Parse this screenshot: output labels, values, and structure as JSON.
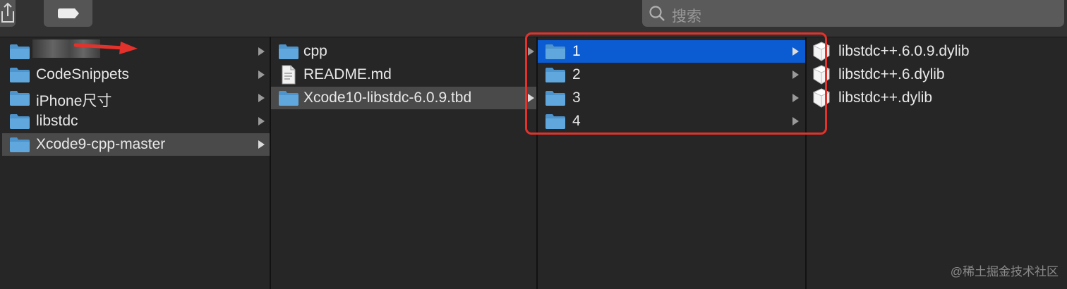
{
  "search": {
    "placeholder": "搜索"
  },
  "columns": [
    {
      "items": [
        {
          "label": "",
          "type": "folder",
          "arrow": true,
          "state": ""
        },
        {
          "label": "CodeSnippets",
          "type": "folder",
          "arrow": true,
          "state": ""
        },
        {
          "label": "iPhone尺寸",
          "type": "folder",
          "arrow": true,
          "state": ""
        },
        {
          "label": "libstdc",
          "type": "folder",
          "arrow": true,
          "state": ""
        },
        {
          "label": "Xcode9-cpp-master",
          "type": "folder",
          "arrow": true,
          "state": "selected-inactive"
        }
      ]
    },
    {
      "items": [
        {
          "label": "cpp",
          "type": "folder",
          "arrow": true,
          "state": ""
        },
        {
          "label": "README.md",
          "type": "document",
          "arrow": false,
          "state": ""
        },
        {
          "label": "Xcode10-libstdc-6.0.9.tbd",
          "type": "folder",
          "arrow": true,
          "state": "selected-inactive"
        }
      ]
    },
    {
      "items": [
        {
          "label": "1",
          "type": "folder",
          "arrow": true,
          "state": "selected-active"
        },
        {
          "label": "2",
          "type": "folder",
          "arrow": true,
          "state": ""
        },
        {
          "label": "3",
          "type": "folder",
          "arrow": true,
          "state": ""
        },
        {
          "label": "4",
          "type": "folder",
          "arrow": true,
          "state": ""
        }
      ]
    },
    {
      "items": [
        {
          "label": "libstdc++.6.0.9.dylib",
          "type": "dylib",
          "arrow": false,
          "state": ""
        },
        {
          "label": "libstdc++.6.dylib",
          "type": "dylib",
          "arrow": false,
          "state": ""
        },
        {
          "label": "libstdc++.dylib",
          "type": "dylib",
          "arrow": false,
          "state": ""
        }
      ]
    }
  ],
  "watermark": "@稀土掘金技术社区",
  "colors": {
    "selection_active": "#0b5bd2",
    "selection_inactive": "#4a4a4a",
    "annotation": "#e3322c",
    "folder": "#5fa7dd"
  }
}
